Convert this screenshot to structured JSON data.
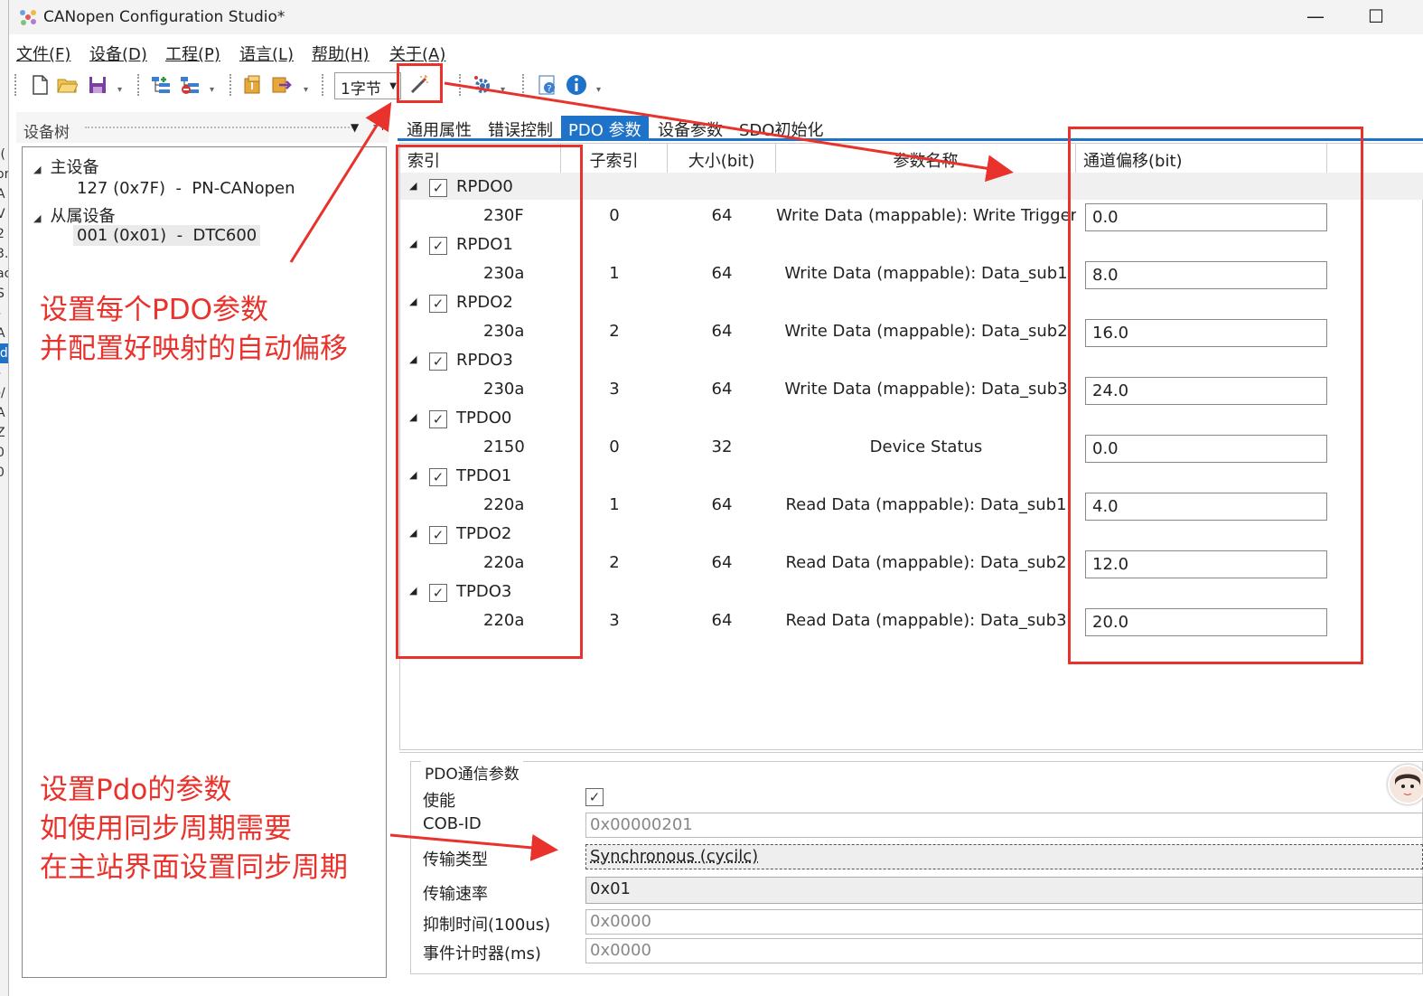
{
  "window": {
    "title": "CANopen Configuration Studio*",
    "minimize": "—",
    "maximize": "☐"
  },
  "left_strip_chars": [
    ".(",
    "or",
    "A",
    "V",
    "2",
    "3.",
    "ac",
    "S",
    "-",
    "A",
    "ld",
    "-",
    "-/",
    "A",
    "Z",
    "0",
    "0"
  ],
  "menu": [
    "文件(F)",
    "设备(D)",
    "工程(P)",
    "语言(L)",
    "帮助(H)",
    "关于(A)"
  ],
  "toolbar": {
    "byte_combo": "1字节",
    "icons": [
      "new-file-icon",
      "open-folder-icon",
      "save-icon",
      "add-node-icon",
      "remove-node-icon",
      "import-icon",
      "export-icon",
      "magic-wand-icon",
      "settings-icon",
      "help-icon",
      "info-icon"
    ]
  },
  "device_tree": {
    "title": "设备树",
    "nodes": [
      {
        "label": "主设备",
        "children": [
          "127 (0x7F)  -  PN-CANopen"
        ]
      },
      {
        "label": "从属设备",
        "children": [
          "001 (0x01)  -  DTC600"
        ]
      }
    ]
  },
  "tabs": [
    "通用属性",
    "错误控制",
    "PDO 参数",
    "设备参数",
    "SDO初始化"
  ],
  "active_tab": "PDO 参数",
  "grid": {
    "columns": [
      "索引",
      "子索引",
      "大小(bit)",
      "参数名称",
      "通道偏移(bit)"
    ],
    "groups": [
      {
        "name": "RPDO0",
        "index": "230F",
        "sub": "0",
        "size": "64",
        "param": "Write Data (mappable): Write Trigger",
        "offset": "0.0"
      },
      {
        "name": "RPDO1",
        "index": "230a",
        "sub": "1",
        "size": "64",
        "param": "Write Data (mappable): Data_sub1",
        "offset": "8.0"
      },
      {
        "name": "RPDO2",
        "index": "230a",
        "sub": "2",
        "size": "64",
        "param": "Write Data (mappable): Data_sub2",
        "offset": "16.0"
      },
      {
        "name": "RPDO3",
        "index": "230a",
        "sub": "3",
        "size": "64",
        "param": "Write Data (mappable): Data_sub3",
        "offset": "24.0"
      },
      {
        "name": "TPDO0",
        "index": "2150",
        "sub": "0",
        "size": "32",
        "param": "Device Status",
        "offset": "0.0"
      },
      {
        "name": "TPDO1",
        "index": "220a",
        "sub": "1",
        "size": "64",
        "param": "Read Data (mappable): Data_sub1",
        "offset": "4.0"
      },
      {
        "name": "TPDO2",
        "index": "220a",
        "sub": "2",
        "size": "64",
        "param": "Read Data (mappable): Data_sub2",
        "offset": "12.0"
      },
      {
        "name": "TPDO3",
        "index": "220a",
        "sub": "3",
        "size": "64",
        "param": "Read Data (mappable): Data_sub3",
        "offset": "20.0"
      }
    ]
  },
  "pdo_comm": {
    "title": "PDO通信参数",
    "enable_label": "使能",
    "cobid_label": "COB-ID",
    "cobid_value": "0x00000201",
    "trans_type_label": "传输类型",
    "trans_type_value": "Synchronous (cycilc)",
    "trans_rate_label": "传输速率",
    "trans_rate_value": "0x01",
    "inhibit_label": "抑制时间(100us)",
    "inhibit_value": "0x0000",
    "event_label": "事件计时器(ms)",
    "event_value": "0x0000"
  },
  "annotations": {
    "a1_line1": "设置每个PDO参数",
    "a1_line2": "并配置好映射的自动偏移",
    "a2_line1": "设置Pdo的参数",
    "a2_line2": "如使用同步周期需要",
    "a2_line3": "在主站界面设置同步周期"
  },
  "colors": {
    "accent": "#1e73c8",
    "annotation": "#e8322b"
  }
}
